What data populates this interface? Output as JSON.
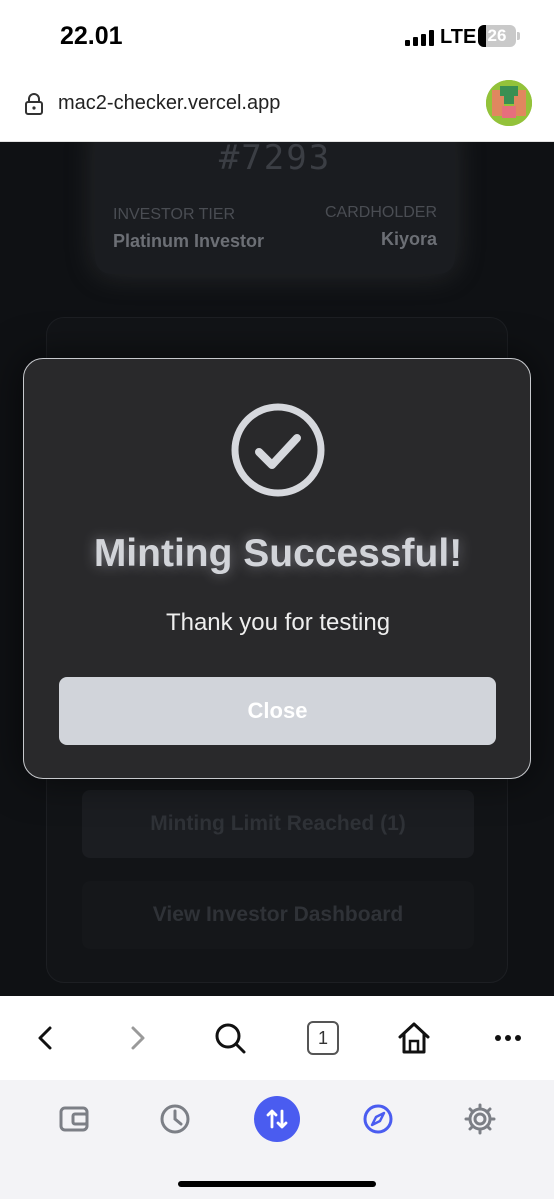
{
  "status_bar": {
    "time": "22.01",
    "network": "LTE",
    "battery": "26"
  },
  "url_bar": {
    "url": "mac2-checker.vercel.app"
  },
  "card": {
    "number": "#7293",
    "tier_label": "INVESTOR TIER",
    "tier_value": "Platinum Investor",
    "holder_label": "CARDHOLDER",
    "holder_value": "Kiyora"
  },
  "background_buttons": {
    "minting_limit": "Minting Limit Reached (1)",
    "dashboard": "View Investor Dashboard"
  },
  "modal": {
    "title": "Minting Successful!",
    "subtitle": "Thank you for testing",
    "close_label": "Close"
  },
  "toolbar": {
    "tab_count": "1"
  },
  "colors": {
    "accent": "#4a5cf0",
    "modal_bg": "#29292b",
    "page_bg": "#0f1114"
  }
}
